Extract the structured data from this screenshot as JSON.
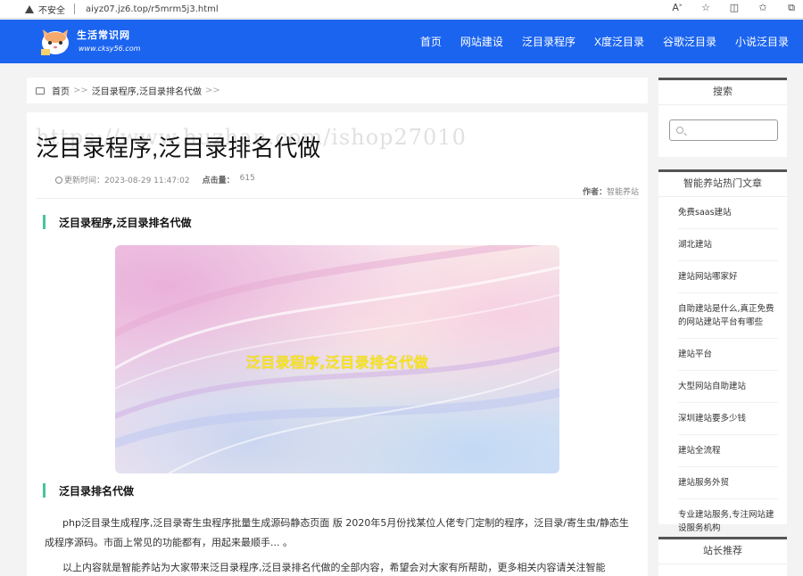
{
  "browser": {
    "insecure_label": "不安全",
    "url": "aiyz07.jz6.top/r5mrm5j3.html",
    "icons": [
      "read-aloud-icon",
      "favorite-star-icon",
      "split-screen-icon",
      "favorites-icon",
      "collections-icon"
    ]
  },
  "header": {
    "logo_title": "生活常识网",
    "logo_subtitle": "www.cksy56.com",
    "bg_color": "#1b64f0",
    "nav": [
      "首页",
      "网站建设",
      "泛目录程序",
      "X度泛目录",
      "谷歌泛目录",
      "小说泛目录"
    ]
  },
  "breadcrumb": {
    "home": "首页",
    "sep": ">>",
    "current": "泛目录程序,泛目录排名代做",
    "tail": ">>"
  },
  "article": {
    "title": "泛目录程序,泛目录排名代做",
    "watermark": "https://www.huzhan.com/ishop27010",
    "updated_label": "更新时间：",
    "updated_value": "2023-08-29 11:47:02",
    "hits_label": "点击量：",
    "hits_value": "615",
    "author_label": "作者：",
    "author_value": "智能养站",
    "section1": "泛目录程序,泛目录排名代做",
    "banner_text": "泛目录程序,泛目录排名代做",
    "section2": "泛目录排名代做",
    "para1": "php泛目录生成程序,泛目录寄生虫程序批量生成源码静态页面 版 2020年5月份找某位人佬专门定制的程序，泛目录/寄生虫/静态生成程序源码。市面上常见的功能都有，用起来最顺手... 。",
    "para2": "以上内容就是智能养站为大家带来泛目录程序,泛目录排名代做的全部内容，希望会对大家有所帮助，更多相关内容请关注智能"
  },
  "sidebar": {
    "search_title": "搜索",
    "hot_title": "智能养站热门文章",
    "hot_items": [
      "免费saas建站",
      "湖北建站",
      "建站网站哪家好",
      "自助建站是什么,真正免费的网站建站平台有哪些",
      "建站平台",
      "大型网站自助建站",
      "深圳建站要多少钱",
      "建站全流程",
      "建站服务外贸",
      "专业建站服务,专注网站建设服务机构"
    ],
    "rec_title": "站长推荐"
  }
}
